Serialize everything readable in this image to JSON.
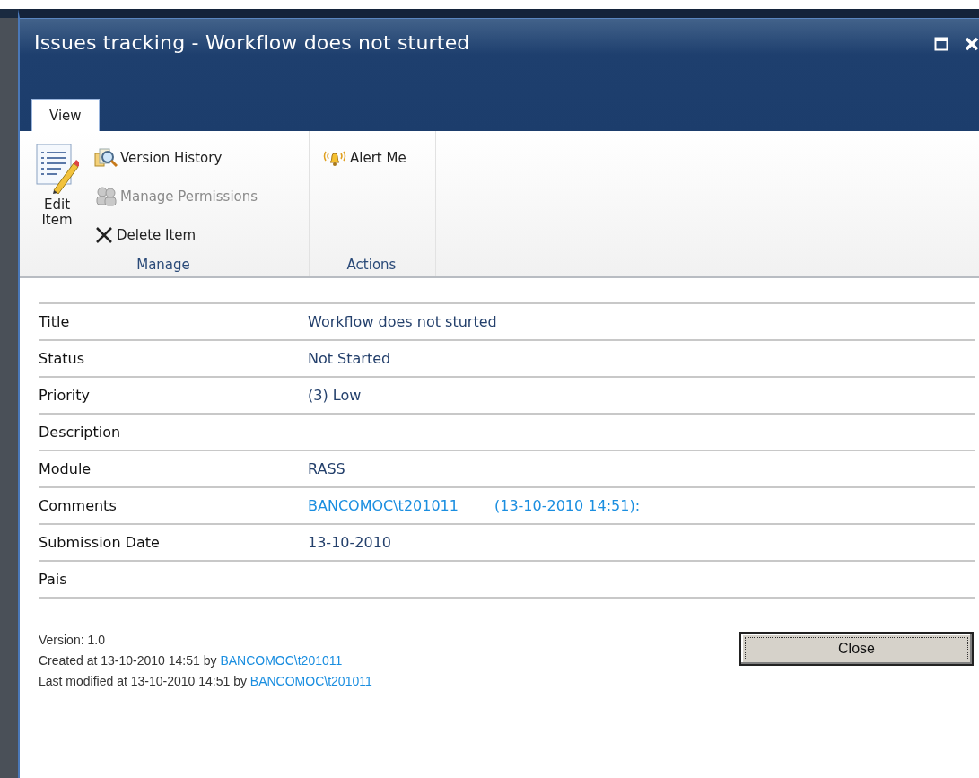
{
  "window": {
    "title": "Issues tracking - Workflow does not sturted",
    "controls": [
      {
        "kind": "maximize"
      },
      {
        "kind": "close"
      }
    ]
  },
  "tabs": [
    {
      "label": "View",
      "selected": true
    }
  ],
  "ribbon": {
    "groups": [
      {
        "label": "Manage",
        "items": [
          {
            "kind": "large",
            "label": "Edit Item",
            "disabled": false
          },
          {
            "kind": "small",
            "label": "Version History",
            "disabled": false
          },
          {
            "kind": "small",
            "label": "Manage Permissions",
            "disabled": true
          },
          {
            "kind": "small",
            "label": "Delete Item",
            "disabled": false
          }
        ]
      },
      {
        "label": "Actions",
        "items": [
          {
            "kind": "small",
            "label": "Alert Me",
            "disabled": false
          }
        ]
      }
    ]
  },
  "fields": [
    {
      "label": "Title",
      "value": "Workflow does not sturted"
    },
    {
      "label": "Status",
      "value": "Not Started"
    },
    {
      "label": "Priority",
      "value": "(3) Low"
    },
    {
      "label": "Description"
    },
    {
      "label": "Module",
      "value": "RASS"
    },
    {
      "label": "Comments",
      "links": [
        "BANCOMOC\\t201011",
        "(13-10-2010 14:51):"
      ]
    },
    {
      "label": "Submission Date",
      "value": "13-10-2010"
    },
    {
      "label": "Pais"
    }
  ],
  "footer": {
    "version": "Version: 1.0",
    "lines": [
      {
        "text": "Created at 13-10-2010 14:51 by",
        "link": "BANCOMOC\\t201011"
      },
      {
        "text": "Last modified at 13-10-2010 14:51 by",
        "link": "BANCOMOC\\t201011"
      }
    ],
    "button": {
      "label": "Close",
      "focused": true
    }
  }
}
